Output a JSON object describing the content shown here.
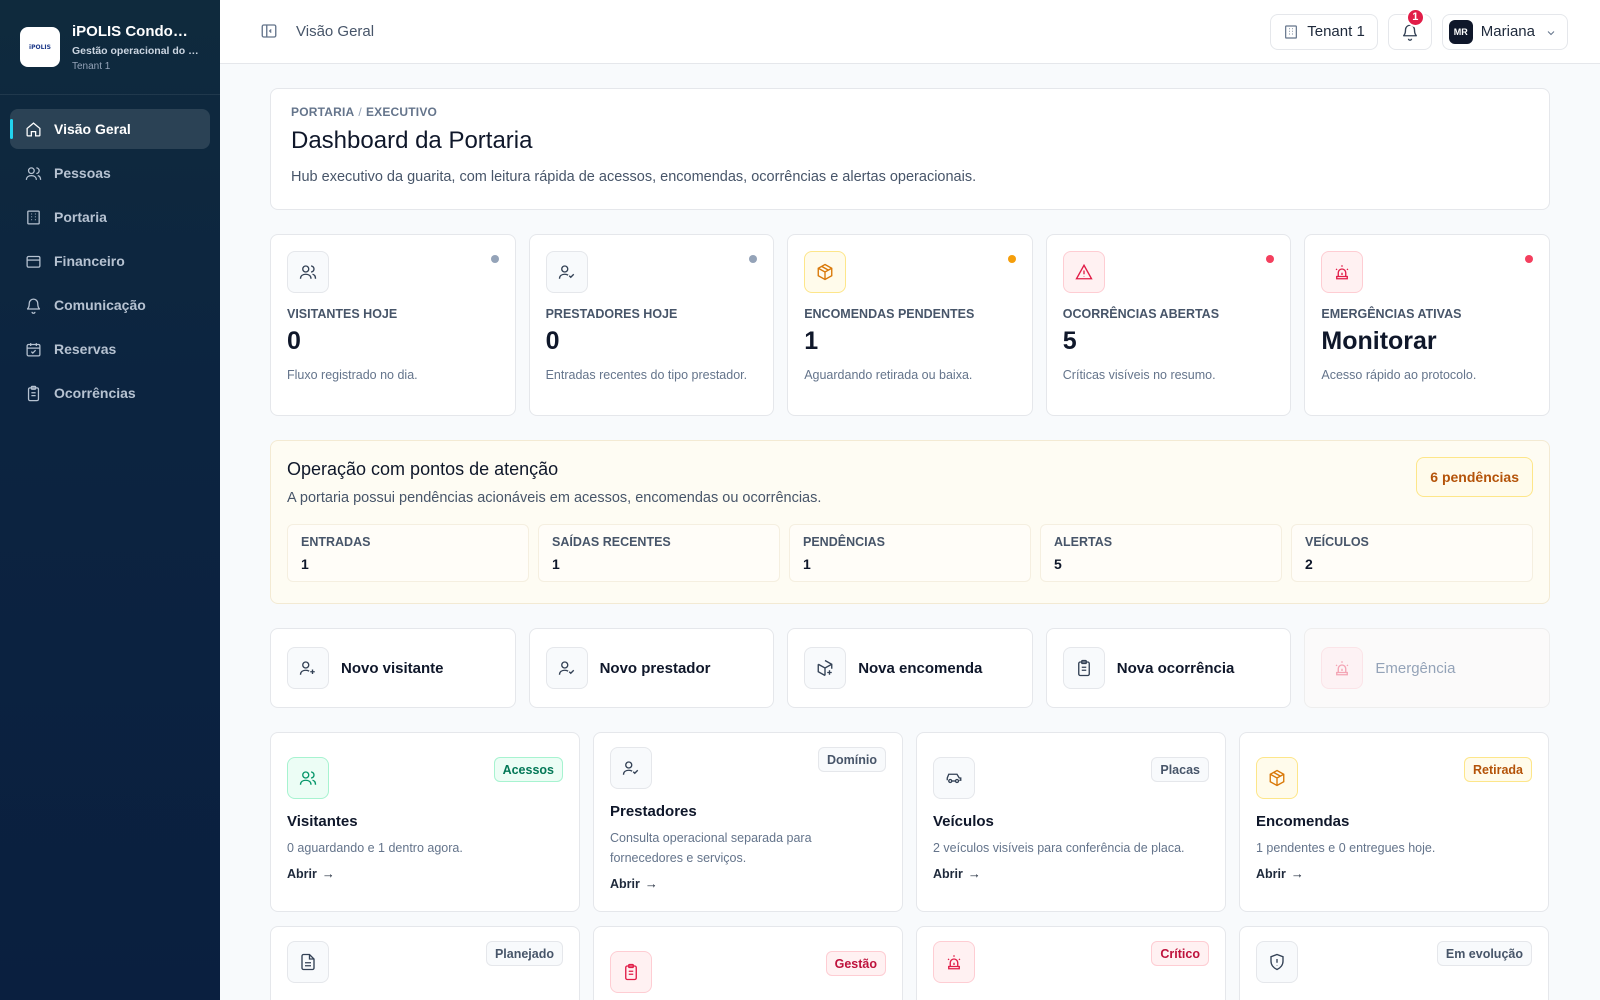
{
  "brand": {
    "logo_text": "iPOLIS",
    "name": "iPOLIS Condomínio",
    "subtitle": "Gestão operacional do condomínio",
    "tenant": "Tenant 1"
  },
  "sidebar": {
    "items": [
      {
        "label": "Visão Geral",
        "icon": "home-icon"
      },
      {
        "label": "Pessoas",
        "icon": "users-icon"
      },
      {
        "label": "Portaria",
        "icon": "building-icon"
      },
      {
        "label": "Financeiro",
        "icon": "wallet-icon"
      },
      {
        "label": "Comunicação",
        "icon": "bell-icon"
      },
      {
        "label": "Reservas",
        "icon": "calendar-icon"
      },
      {
        "label": "Ocorrências",
        "icon": "clipboard-icon"
      }
    ]
  },
  "topbar": {
    "title": "Visão Geral",
    "tenant": "Tenant 1",
    "notifications": "1",
    "user_initials": "MR",
    "user_name": "Mariana"
  },
  "hero": {
    "crumb_1": "PORTARIA",
    "crumb_sep": "/",
    "crumb_2": "EXECUTIVO",
    "title": "Dashboard da Portaria",
    "description": "Hub executivo da guarita, com leitura rápida de acessos, encomendas, ocorrências e alertas operacionais."
  },
  "stats": [
    {
      "label": "VISITANTES HOJE",
      "value": "0",
      "desc": "Fluxo registrado no dia.",
      "icon": "users-icon",
      "dot": "#94a3b8",
      "tone": "#334155"
    },
    {
      "label": "PRESTADORES HOJE",
      "value": "0",
      "desc": "Entradas recentes do tipo prestador.",
      "icon": "user-check-icon",
      "dot": "#94a3b8",
      "tone": "#334155"
    },
    {
      "label": "ENCOMENDAS PENDENTES",
      "value": "1",
      "desc": "Aguardando retirada ou baixa.",
      "icon": "package-icon",
      "dot": "#f59e0b",
      "tone": "#d97706"
    },
    {
      "label": "OCORRÊNCIAS ABERTAS",
      "value": "5",
      "desc": "Críticas visíveis no resumo.",
      "icon": "alert-triangle-icon",
      "dot": "#f43f5e",
      "tone": "#e11d48"
    },
    {
      "label": "EMERGÊNCIAS ATIVAS",
      "value": "Monitorar",
      "desc": "Acesso rápido ao protocolo.",
      "icon": "siren-icon",
      "dot": "#f43f5e",
      "tone": "#e11d48"
    }
  ],
  "attention": {
    "title": "Operação com pontos de atenção",
    "description": "A portaria possui pendências acionáveis em acessos, encomendas ou ocorrências.",
    "badge": "6 pendências",
    "metrics": [
      {
        "label": "ENTRADAS",
        "value": "1"
      },
      {
        "label": "SAÍDAS RECENTES",
        "value": "1"
      },
      {
        "label": "PENDÊNCIAS",
        "value": "1"
      },
      {
        "label": "ALERTAS",
        "value": "5"
      },
      {
        "label": "VEÍCULOS",
        "value": "2"
      }
    ]
  },
  "actions": [
    {
      "label": "Novo visitante",
      "icon": "user-plus-icon"
    },
    {
      "label": "Novo prestador",
      "icon": "user-check-icon"
    },
    {
      "label": "Nova encomenda",
      "icon": "package-plus-icon"
    },
    {
      "label": "Nova ocorrência",
      "icon": "clipboard-icon"
    },
    {
      "label": "Emergência",
      "icon": "siren-icon"
    }
  ],
  "modules": [
    {
      "title": "Visitantes",
      "tag": "Acessos",
      "desc": "0 aguardando e 1 dentro agora.",
      "link": "Abrir",
      "icon": "users-icon"
    },
    {
      "title": "Prestadores",
      "tag": "Domínio",
      "desc": "Consulta operacional separada para fornecedores e serviços.",
      "link": "Abrir",
      "icon": "user-check-icon"
    },
    {
      "title": "Veículos",
      "tag": "Placas",
      "desc": "2 veículos visíveis para conferência de placa.",
      "link": "Abrir",
      "icon": "car-icon"
    },
    {
      "title": "Encomendas",
      "tag": "Retirada",
      "desc": "1 pendentes e 0 entregues hoje.",
      "link": "Abrir",
      "icon": "package-icon"
    }
  ],
  "modules_row2": [
    {
      "tag": "Planejado",
      "icon": "file-icon"
    },
    {
      "tag": "Gestão",
      "icon": "clipboard-icon"
    },
    {
      "tag": "Crítico",
      "icon": "siren-icon"
    },
    {
      "tag": "Em evolução",
      "icon": "shield-icon"
    }
  ],
  "link_arrow": "→"
}
